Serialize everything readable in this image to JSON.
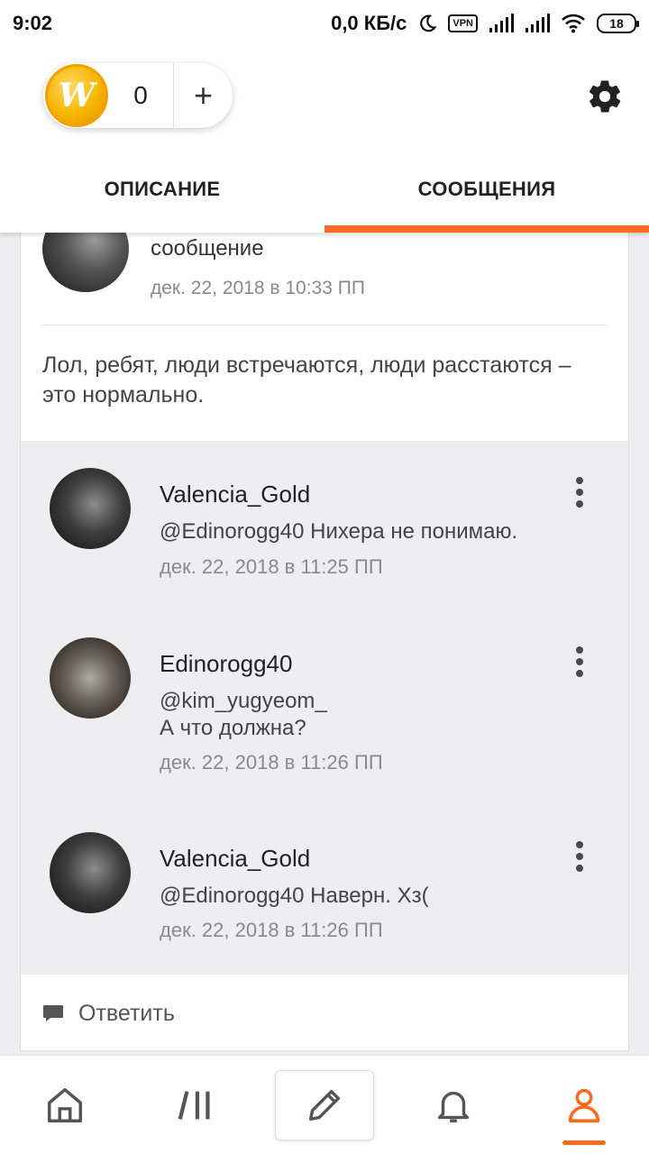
{
  "status_bar": {
    "time": "9:02",
    "net_speed": "0,0 КБ/с",
    "vpn": "VPN",
    "battery": "18"
  },
  "top_bar": {
    "coin_count": "0",
    "coin_letter": "W",
    "add_label": "+"
  },
  "tabs": [
    {
      "label": "ОПИСАНИЕ",
      "active": false
    },
    {
      "label": "СООБЩЕНИЯ",
      "active": true
    }
  ],
  "parent": {
    "text": "сообщение",
    "time": "дек. 22, 2018 в 10:33 ПП",
    "body": "Лол, ребят, люди встречаются, люди расстаются – это нормально."
  },
  "replies": [
    {
      "author": "Valencia_Gold",
      "message": "@Edinorogg40  Нихера не понимаю.",
      "time": "дек. 22, 2018 в 11:25 ПП"
    },
    {
      "author": "Edinorogg40",
      "message_line1": "@kim_yugyeom_",
      "message_line2": "А что должна?",
      "time": "дек. 22, 2018 в 11:26 ПП"
    },
    {
      "author": "Valencia_Gold",
      "message": "@Edinorogg40  Наверн. Хз(",
      "time": "дек. 22, 2018 в 11:26 ПП"
    }
  ],
  "reply_action": "Ответить",
  "colors": {
    "accent": "#ff6a22",
    "reply_bg": "#eeedf0"
  },
  "bottom_nav": [
    "home-icon",
    "library-icon",
    "pencil-icon",
    "bell-icon",
    "profile-icon"
  ]
}
